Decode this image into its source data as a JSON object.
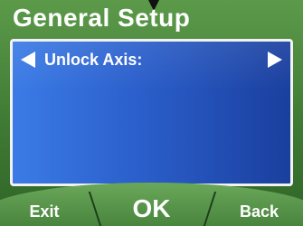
{
  "screen": {
    "title": "General Setup",
    "setting_label": "Unlock Axis:"
  },
  "softkeys": {
    "exit_label": "Exit",
    "ok_label": "OK",
    "back_label": "Back"
  },
  "colors": {
    "background_green": "#3f7a34",
    "panel_blue": "#2b5fcb",
    "text_white": "#ffffff"
  }
}
